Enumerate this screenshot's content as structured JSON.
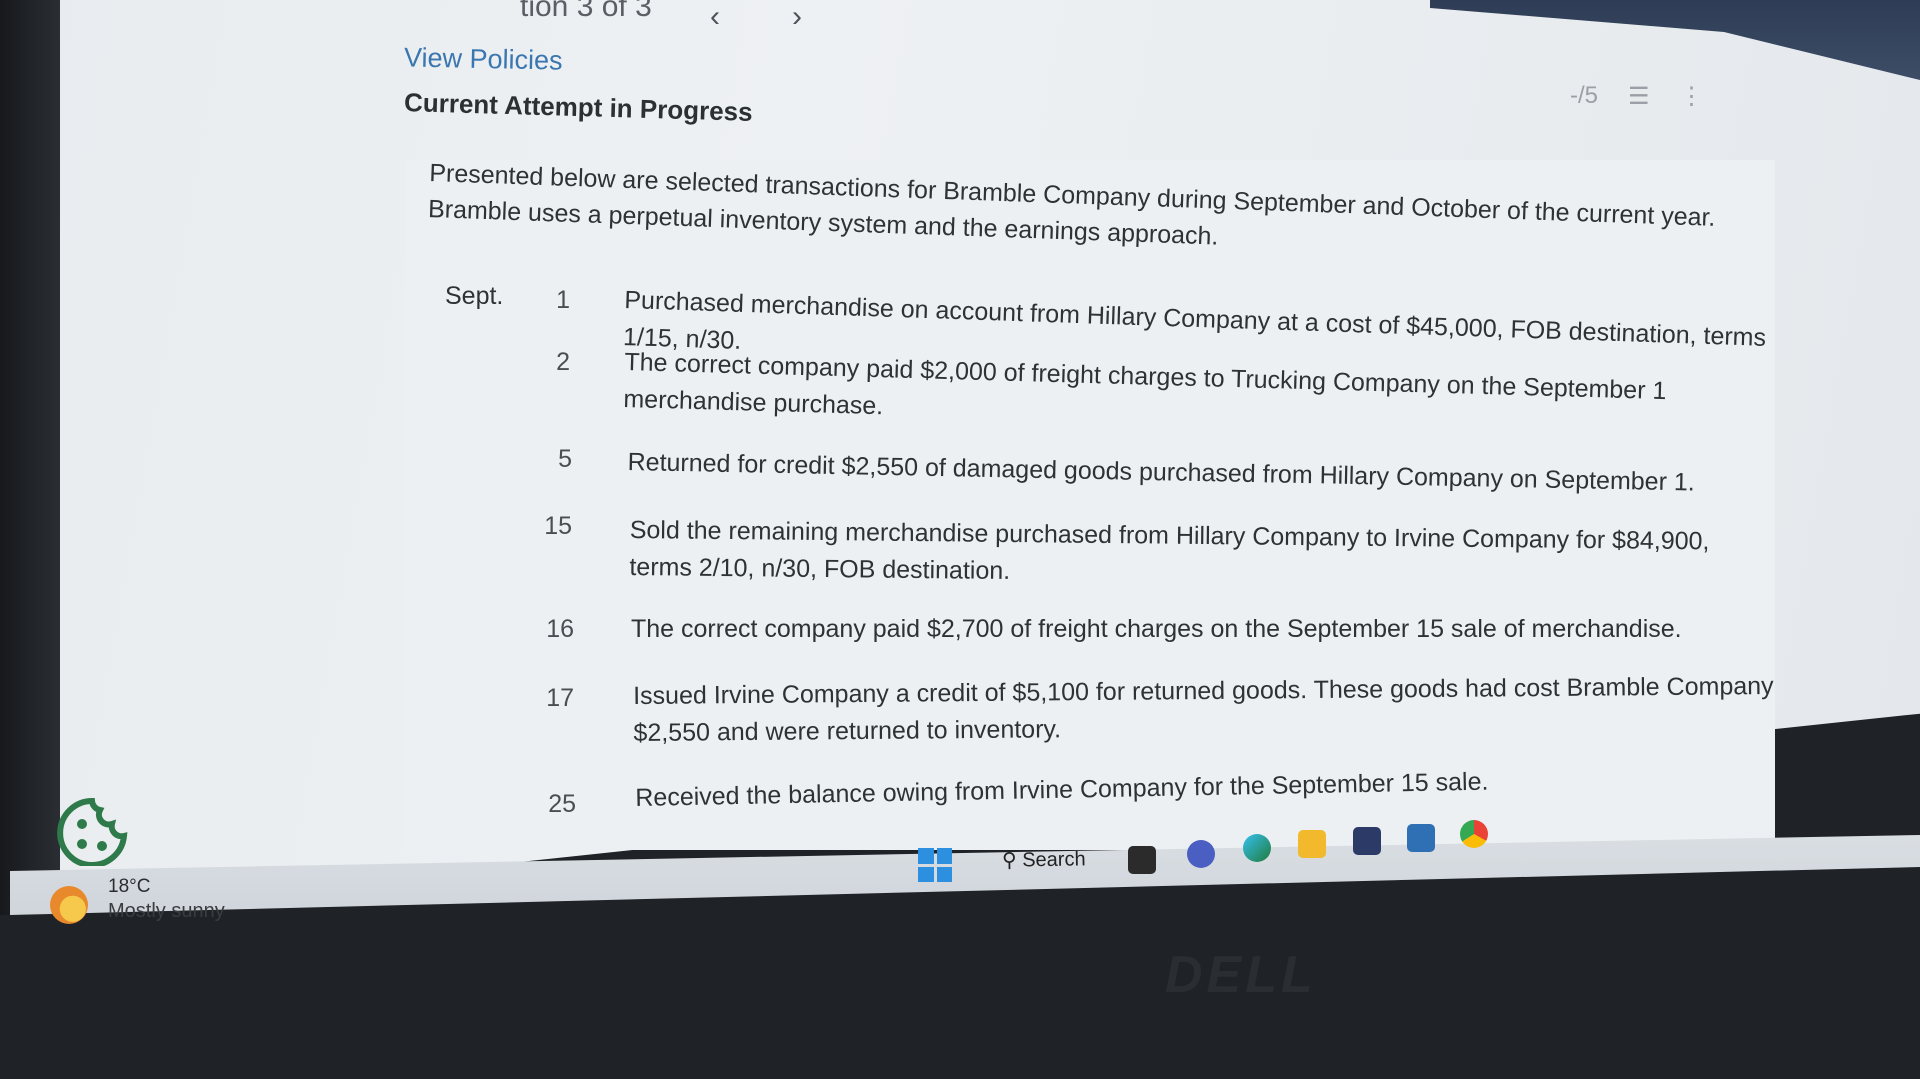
{
  "header": {
    "question_nav_title": "tion 3 of 3",
    "prev_glyph": "‹",
    "next_glyph": "›",
    "view_policies": "View Policies",
    "attempt_status": "Current Attempt in Progress",
    "score_text": "-/5",
    "list_glyph": "☰",
    "more_glyph": "⋮"
  },
  "problem": {
    "intro": "Presented below are selected transactions for Bramble Company during September and October of the current year. Bramble uses a perpetual inventory system and the earnings approach.",
    "transactions": [
      {
        "month": "Sept.",
        "day": "1",
        "text": "Purchased merchandise on account from Hillary Company at a cost of $45,000, FOB destination, terms 1/15, n/30."
      },
      {
        "month": "",
        "day": "2",
        "text": "The correct company paid $2,000 of freight charges to Trucking Company on the September 1 merchandise purchase."
      },
      {
        "month": "",
        "day": "5",
        "text": "Returned for credit $2,550 of damaged goods purchased from Hillary Company on September 1."
      },
      {
        "month": "",
        "day": "15",
        "text": "Sold the remaining merchandise purchased from Hillary Company to Irvine Company for $84,900, terms 2/10, n/30, FOB destination."
      },
      {
        "month": "",
        "day": "16",
        "text": "The correct company paid $2,700 of freight charges on the September 15 sale of merchandise."
      },
      {
        "month": "",
        "day": "17",
        "text": "Issued Irvine Company a credit of $5,100 for returned goods. These goods had cost Bramble Company $2,550 and were returned to inventory."
      },
      {
        "month": "",
        "day": "25",
        "text": "Received the balance owing from Irvine Company for the September 15 sale."
      }
    ]
  },
  "taskbar": {
    "weather_temp": "18°C",
    "weather_desc": "Mostly sunny",
    "search_label": "Search",
    "icons": [
      "task-view-icon",
      "chat-icon",
      "edge-icon",
      "file-explorer-icon",
      "store-icon",
      "mail-icon",
      "chrome-icon"
    ]
  },
  "bezel": {
    "brand": "DELL"
  }
}
